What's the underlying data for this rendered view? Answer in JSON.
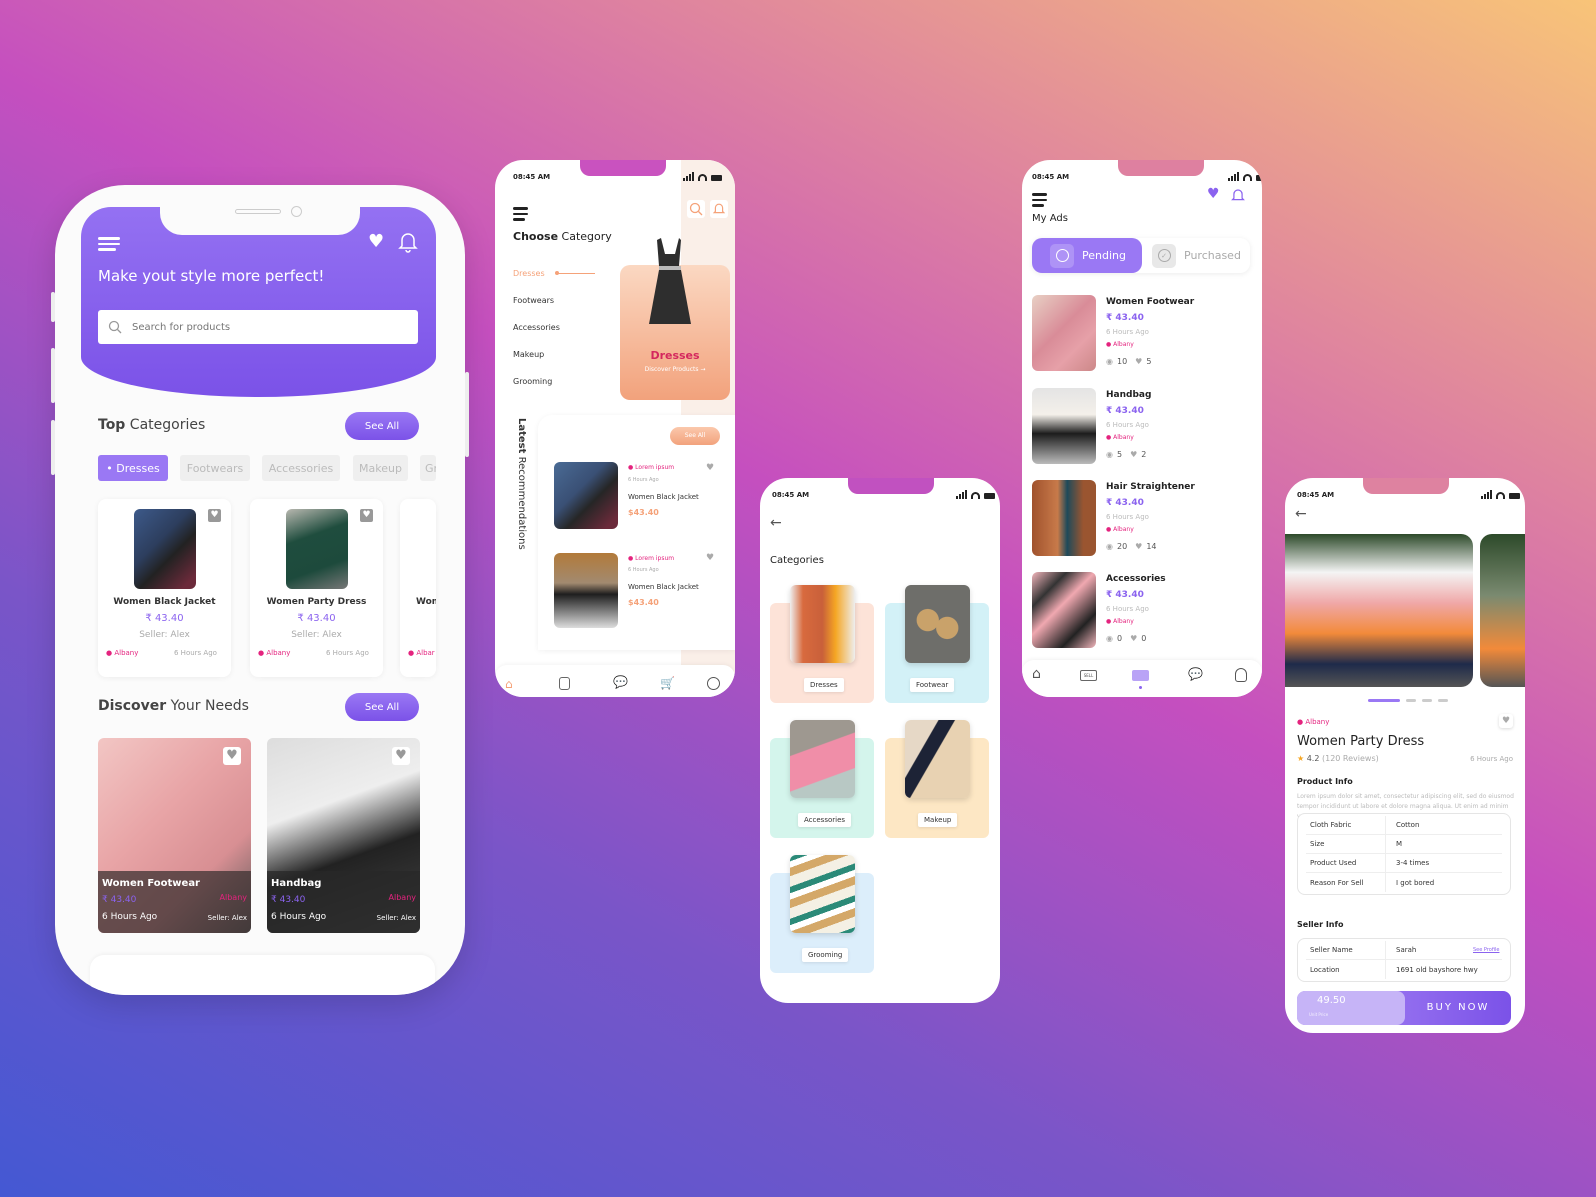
{
  "colors": {
    "primary": "#8b63ef",
    "accent_orange": "#f5a279",
    "location_pink": "#e4237e"
  },
  "home": {
    "tagline": "Make yout style more perfect!",
    "search_placeholder": "Search for products",
    "top_categories": {
      "bold": "Top",
      "rest": " Categories",
      "see_all": "See All"
    },
    "chips": [
      "• Dresses",
      "Footwears",
      "Accessories",
      "Makeup",
      "Gr"
    ],
    "products": [
      {
        "name": "Women Black Jacket",
        "price": "₹ 43.40",
        "seller": "Seller: Alex",
        "location": "Albany",
        "time": "6 Hours Ago"
      },
      {
        "name": "Women Party Dress",
        "price": "₹ 43.40",
        "seller": "Seller: Alex",
        "location": "Albany",
        "time": "6 Hours Ago"
      },
      {
        "name": "Wom",
        "location": "Albar"
      }
    ],
    "discover": {
      "bold": "Discover",
      "rest": " Your Needs",
      "see_all": "See All"
    },
    "discover_items": [
      {
        "name": "Women Footwear",
        "price": "₹ 43.40",
        "location": "Albany",
        "time": "6 Hours Ago",
        "seller": "Seller: Alex"
      },
      {
        "name": "Handbag",
        "price": "₹ 43.40",
        "location": "Albany",
        "time": "6 Hours Ago",
        "seller": "Seller: Alex"
      }
    ]
  },
  "choose": {
    "time": "08:45 AM",
    "title_bold": "Choose",
    "title_rest": " Category",
    "menu": [
      "Dresses",
      "Footwears",
      "Accessories",
      "Makeup",
      "Grooming"
    ],
    "feature": {
      "title": "Dresses",
      "sub": "Discover Products →"
    },
    "latest_bold": "Latest",
    "latest_rest": " Recommendations",
    "see_all": "See All",
    "items": [
      {
        "location": "Lorem ipsum",
        "time": "6 Hours Ago",
        "name": "Women Black Jacket",
        "price": "$43.40"
      },
      {
        "location": "Lorem ipsum",
        "time": "6 Hours Ago",
        "name": "Women Black Jacket",
        "price": "$43.40"
      }
    ]
  },
  "categories": {
    "time": "08:45 AM",
    "title": "Categories",
    "items": [
      "Dresses",
      "Footwear",
      "Accessories",
      "Makeup",
      "Grooming"
    ]
  },
  "myads": {
    "time": "08:45 AM",
    "title": "My Ads",
    "tabs": [
      "Pending",
      "Purchased"
    ],
    "ads": [
      {
        "name": "Women Footwear",
        "price": "₹ 43.40",
        "time": "6 Hours Ago",
        "location": "Albany",
        "views": "10",
        "likes": "5"
      },
      {
        "name": "Handbag",
        "price": "₹ 43.40",
        "time": "6 Hours Ago",
        "location": "Albany",
        "views": "5",
        "likes": "2"
      },
      {
        "name": "Hair Straightener",
        "price": "₹ 43.40",
        "time": "6 Hours Ago",
        "location": "Albany",
        "views": "20",
        "likes": "14"
      },
      {
        "name": "Accessories",
        "price": "₹ 43.40",
        "time": "6 Hours Ago",
        "location": "Albany",
        "views": "0",
        "likes": "0"
      }
    ],
    "nav_sell": "SELL"
  },
  "detail": {
    "time": "08:45 AM",
    "location": "Albany",
    "name": "Women Party Dress",
    "rating": "4.2",
    "reviews": "(120 Reviews)",
    "posted": "6 Hours Ago",
    "product_info_title": "Product Info",
    "description": "Lorem ipsum dolor sit amet, consectetur adipiscing elit, sed do eiusmod tempor incididunt ut labore et dolore magna aliqua. Ut enim ad minim veniam.",
    "specs": [
      [
        "Cloth Fabric",
        "Cotton"
      ],
      [
        "Size",
        "M"
      ],
      [
        "Product Used",
        "3-4 times"
      ],
      [
        "Reason For Sell",
        "I got bored"
      ]
    ],
    "seller_title": "Seller Info",
    "seller": [
      [
        "Seller Name",
        "Sarah"
      ],
      [
        "Location",
        "1691 old bayshore hwy"
      ]
    ],
    "see_profile": "See Profile",
    "price": "49.50",
    "price_label": "Unit Price",
    "buy": "BUY NOW",
    "carousel_active": 1,
    "carousel_count": 4
  }
}
